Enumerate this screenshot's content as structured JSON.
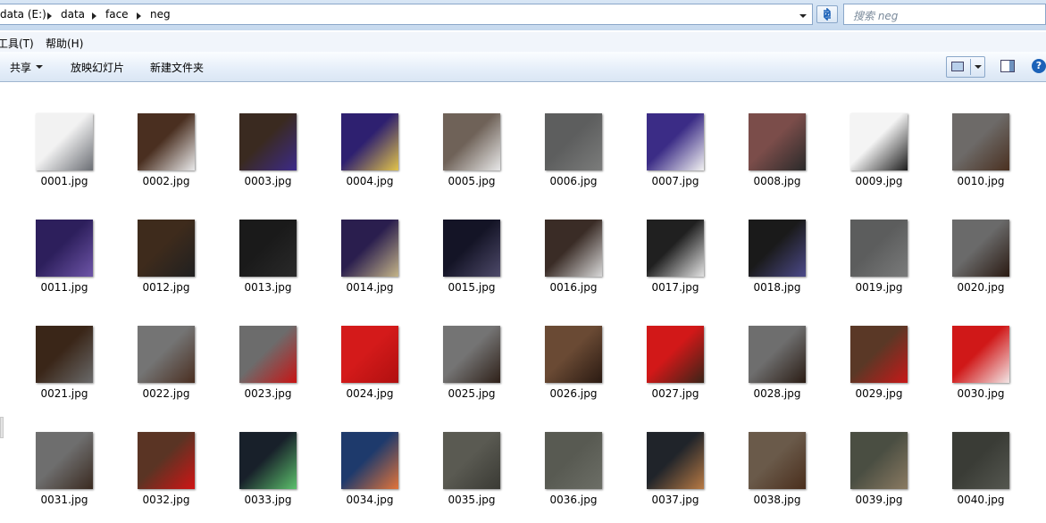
{
  "address": {
    "crumbs": [
      "data (E:)",
      "face",
      "neg"
    ],
    "drive_label": "data (E:)",
    "data_label": "data",
    "face_label": "face",
    "neg_label": "neg"
  },
  "search": {
    "placeholder": "搜索 neg"
  },
  "menubar": {
    "tools_label": "工具(T)",
    "help_label": "帮助(H)"
  },
  "toolbar": {
    "share_label": "共享",
    "slideshow_label": "放映幻灯片",
    "new_folder_label": "新建文件夹"
  },
  "files": [
    {
      "name": "0001.jpg",
      "c1": "#f2f2f2",
      "c2": "#6b6e74"
    },
    {
      "name": "0002.jpg",
      "c1": "#4a2f20",
      "c2": "#e9e9ea"
    },
    {
      "name": "0003.jpg",
      "c1": "#3a2a20",
      "c2": "#3c2a8a"
    },
    {
      "name": "0004.jpg",
      "c1": "#2e2070",
      "c2": "#e2c44a"
    },
    {
      "name": "0005.jpg",
      "c1": "#6f6258",
      "c2": "#e8e8e8"
    },
    {
      "name": "0006.jpg",
      "c1": "#5d5e5e",
      "c2": "#7b7c7b"
    },
    {
      "name": "0007.jpg",
      "c1": "#3b2c86",
      "c2": "#f2f2f2"
    },
    {
      "name": "0008.jpg",
      "c1": "#7b4d4a",
      "c2": "#2a2a2a"
    },
    {
      "name": "0009.jpg",
      "c1": "#f4f4f4",
      "c2": "#1c1c1c"
    },
    {
      "name": "0010.jpg",
      "c1": "#6d6a68",
      "c2": "#4a3020"
    },
    {
      "name": "0011.jpg",
      "c1": "#2d1f5c",
      "c2": "#6e55a8"
    },
    {
      "name": "0012.jpg",
      "c1": "#3e2b1c",
      "c2": "#202020"
    },
    {
      "name": "0013.jpg",
      "c1": "#1a1a1a",
      "c2": "#2a2a2a"
    },
    {
      "name": "0014.jpg",
      "c1": "#2a1e4e",
      "c2": "#c4b488"
    },
    {
      "name": "0015.jpg",
      "c1": "#141426",
      "c2": "#4e4a6a"
    },
    {
      "name": "0016.jpg",
      "c1": "#3a2c26",
      "c2": "#d8d8d8"
    },
    {
      "name": "0017.jpg",
      "c1": "#202020",
      "c2": "#e3e3e3"
    },
    {
      "name": "0018.jpg",
      "c1": "#1a1a1a",
      "c2": "#4c4a8a"
    },
    {
      "name": "0019.jpg",
      "c1": "#5c5d5d",
      "c2": "#7a7b7b"
    },
    {
      "name": "0020.jpg",
      "c1": "#6a6a6a",
      "c2": "#2a1a12"
    },
    {
      "name": "0021.jpg",
      "c1": "#3a2618",
      "c2": "#6a6a6a"
    },
    {
      "name": "0022.jpg",
      "c1": "#747474",
      "c2": "#4a2e20"
    },
    {
      "name": "0023.jpg",
      "c1": "#6c6c6c",
      "c2": "#c81414"
    },
    {
      "name": "0024.jpg",
      "c1": "#d41a1a",
      "c2": "#b01010"
    },
    {
      "name": "0025.jpg",
      "c1": "#747474",
      "c2": "#2e2018"
    },
    {
      "name": "0026.jpg",
      "c1": "#6a4a34",
      "c2": "#2a1a12"
    },
    {
      "name": "0027.jpg",
      "c1": "#d21818",
      "c2": "#3a2418"
    },
    {
      "name": "0028.jpg",
      "c1": "#6e6e6e",
      "c2": "#2a1c14"
    },
    {
      "name": "0029.jpg",
      "c1": "#5a3826",
      "c2": "#c81818"
    },
    {
      "name": "0030.jpg",
      "c1": "#d01818",
      "c2": "#f2e6e6"
    },
    {
      "name": "0031.jpg",
      "c1": "#6e6e6e",
      "c2": "#3a2a20"
    },
    {
      "name": "0032.jpg",
      "c1": "#5a3424",
      "c2": "#d01414"
    },
    {
      "name": "0033.jpg",
      "c1": "#18202a",
      "c2": "#5cc06c"
    },
    {
      "name": "0034.jpg",
      "c1": "#1e3a6c",
      "c2": "#e2743a"
    },
    {
      "name": "0035.jpg",
      "c1": "#5a5a52",
      "c2": "#3a3a34"
    },
    {
      "name": "0036.jpg",
      "c1": "#585a52",
      "c2": "#6c6e66"
    },
    {
      "name": "0037.jpg",
      "c1": "#20242a",
      "c2": "#b87a44"
    },
    {
      "name": "0038.jpg",
      "c1": "#6a5a4a",
      "c2": "#4a2e1c"
    },
    {
      "name": "0039.jpg",
      "c1": "#4a4e42",
      "c2": "#8a7a62"
    },
    {
      "name": "0040.jpg",
      "c1": "#3a3c36",
      "c2": "#555750"
    }
  ]
}
